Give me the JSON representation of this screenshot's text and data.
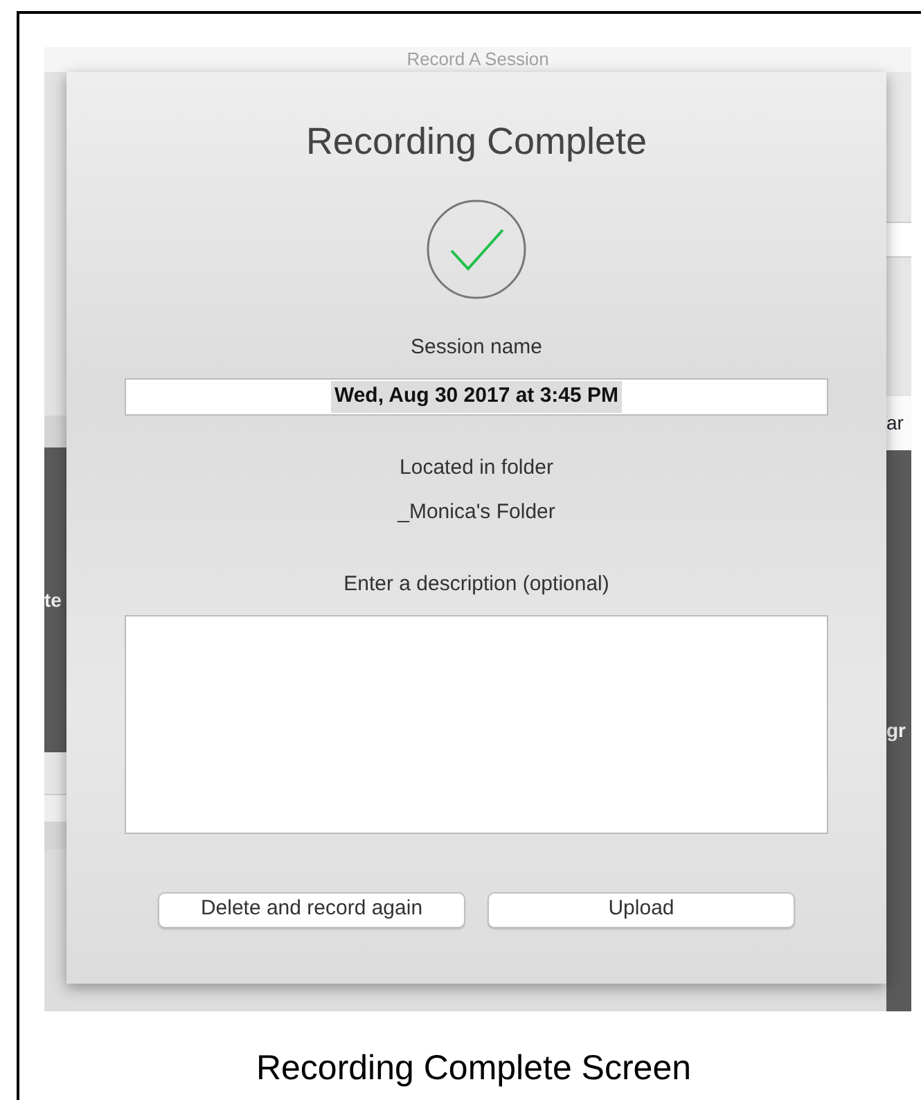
{
  "app": {
    "title": "Record A Session",
    "left_fragment": "te",
    "right_fragments": [
      "ar",
      "gr"
    ]
  },
  "dialog": {
    "title": "Recording Complete",
    "session_label": "Session name",
    "session_value": "Wed, Aug 30 2017 at 3:45 PM",
    "session_text_selected": true,
    "folder_label": "Located in folder",
    "folder_name": "_Monica's Folder",
    "description_label": "Enter a description (optional)",
    "buttons": [
      "Delete and record again",
      "Upload"
    ]
  },
  "caption": "Recording Complete Screen"
}
